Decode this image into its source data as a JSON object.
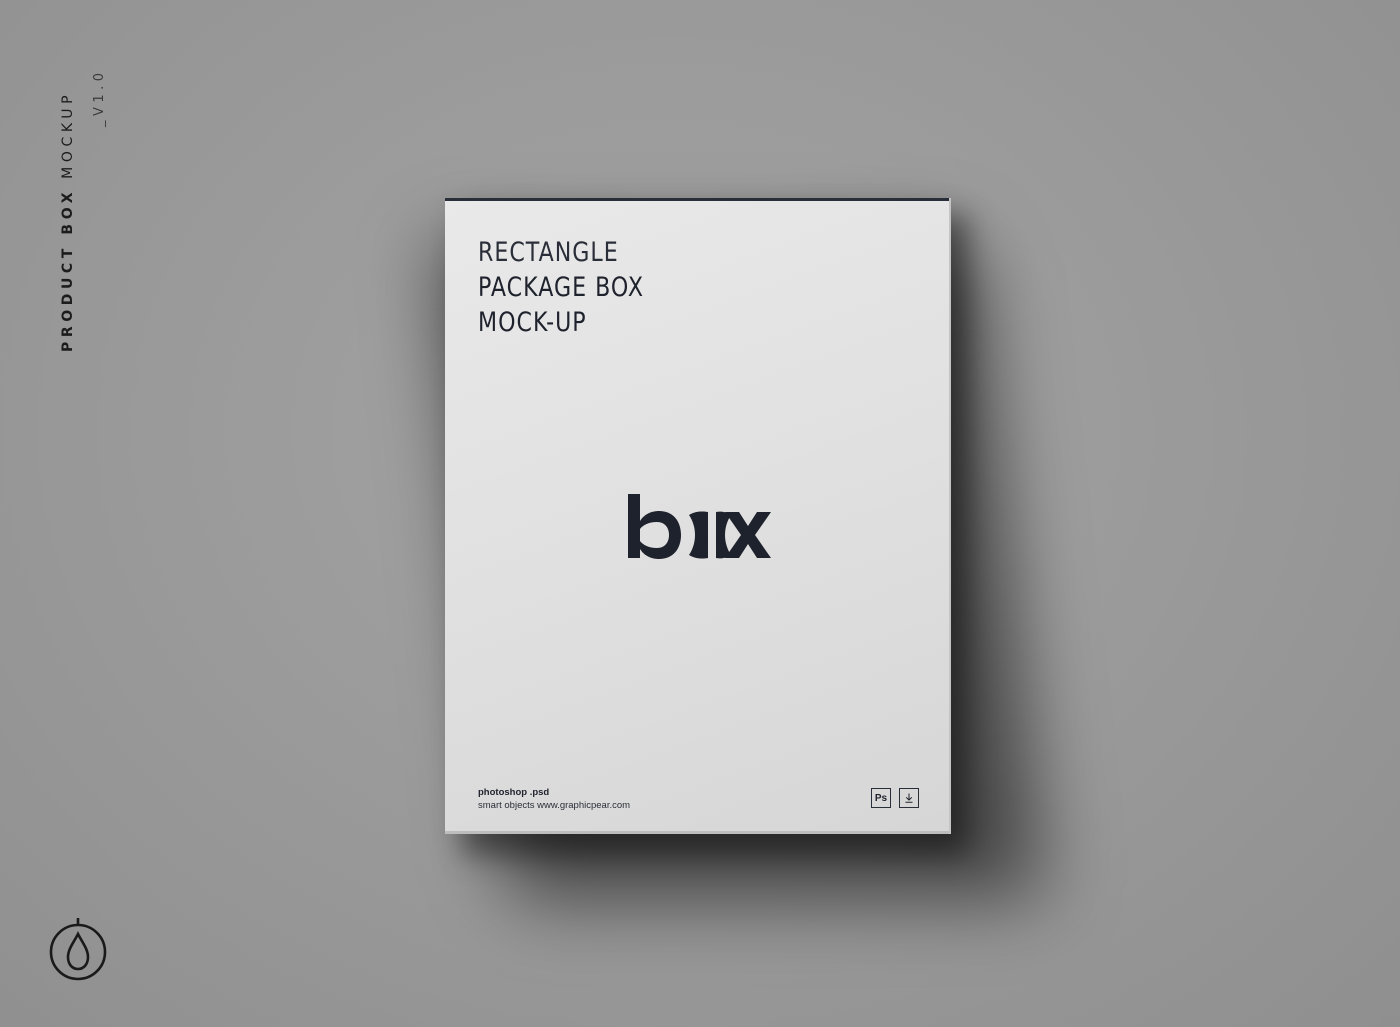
{
  "side": {
    "title_bold": "PRODUCT BOX",
    "title_rest": "MOCKUP",
    "version": "_V1.0"
  },
  "box": {
    "heading_line1": "RECTANGLE",
    "heading_line2": "PACKAGE BOX",
    "heading_line3": "MOCK-UP",
    "logo_text": "box",
    "footer_line1": "photoshop .psd",
    "footer_line2": "smart objects  www.graphicpear.com",
    "badge_ps": "Ps",
    "badge_download_icon": "download-icon"
  },
  "colors": {
    "background": "#9b9b9b",
    "box_face": "#e1e1e1",
    "ink": "#1e222c"
  },
  "brand_icon": "pear-logo-icon"
}
